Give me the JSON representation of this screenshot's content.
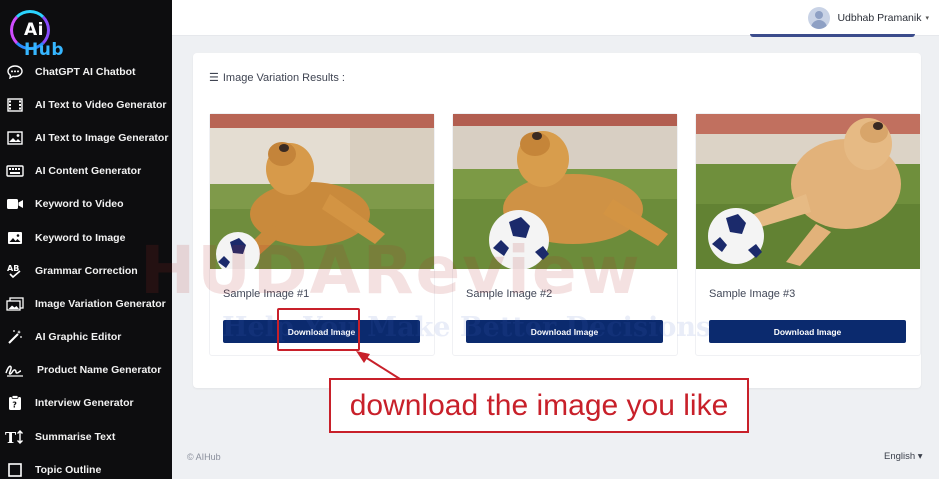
{
  "brand": {
    "prefix": "Ai",
    "suffix": " Hub"
  },
  "sidebar": {
    "items": [
      {
        "label": "ChatGPT AI Chatbot",
        "icon": "chat-bubble-icon"
      },
      {
        "label": "AI Text to Video Generator",
        "icon": "film-icon"
      },
      {
        "label": "AI Text to Image Generator",
        "icon": "image-icon"
      },
      {
        "label": "AI Content Generator",
        "icon": "keyboard-icon"
      },
      {
        "label": "Keyword to Video",
        "icon": "video-camera-icon"
      },
      {
        "label": "Keyword to Image",
        "icon": "picture-icon"
      },
      {
        "label": "Grammar Correction",
        "icon": "spellcheck-icon"
      },
      {
        "label": "Image Variation Generator",
        "icon": "images-icon"
      },
      {
        "label": "AI Graphic Editor",
        "icon": "magic-wand-icon"
      },
      {
        "label": "Product Name Generator",
        "icon": "signature-icon"
      },
      {
        "label": "Interview Generator",
        "icon": "question-clipboard-icon"
      },
      {
        "label": "Summarise Text",
        "icon": "text-height-icon"
      },
      {
        "label": "Topic Outline",
        "icon": "outline-icon"
      }
    ]
  },
  "header": {
    "user_name": "Udbhab Pramanik",
    "caret": "▾"
  },
  "main": {
    "section_title": "Image Variation Results :",
    "results": [
      {
        "caption": "Sample Image #1",
        "button": "Download Image"
      },
      {
        "caption": "Sample Image #2",
        "button": "Download Image"
      },
      {
        "caption": "Sample Image #3",
        "button": "Download Image"
      }
    ]
  },
  "footer": {
    "copyright": "© AIHub",
    "language": "English ▾"
  },
  "watermark": {
    "title": "HUDAReview",
    "tagline": "Help You Make Better Decisions"
  },
  "annotation": {
    "callout": "download the image you like"
  },
  "colors": {
    "sidebar_bg": "#0d0d0f",
    "button_bg": "#0b2a6e",
    "annotation_red": "#c8202a",
    "page_bg": "#eef0f3"
  }
}
